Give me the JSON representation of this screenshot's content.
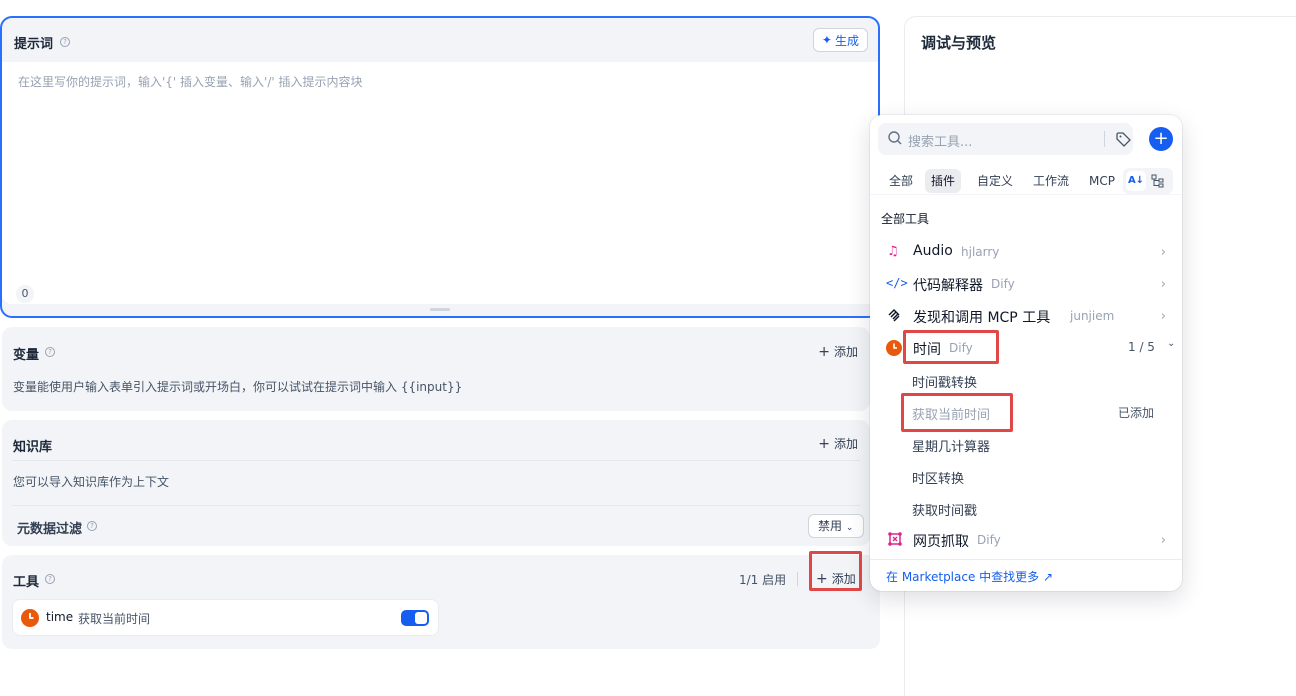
{
  "prompt": {
    "title": "提示词",
    "generate_label": "生成",
    "placeholder": "在这里写你的提示词，输入'{' 插入变量、输入'/' 插入提示内容块",
    "char_count": "0"
  },
  "variables": {
    "title": "变量",
    "add_label": "添加",
    "description": "变量能使用户输入表单引入提示词或开场白，你可以试试在提示词中输入 {{input}}"
  },
  "knowledge": {
    "title": "知识库",
    "add_label": "添加",
    "description": "您可以导入知识库作为上下文",
    "metadata_filter_label": "元数据过滤",
    "metadata_filter_value": "禁用"
  },
  "tools": {
    "title": "工具",
    "enabled_count": "1/1 启用",
    "add_label": "添加",
    "items": [
      {
        "name": "time",
        "action": "获取当前时间",
        "enabled": true
      }
    ]
  },
  "debug": {
    "title": "调试与预览"
  },
  "tool_picker": {
    "search_placeholder": "搜索工具...",
    "tabs": [
      "全部",
      "插件",
      "自定义",
      "工作流",
      "MCP"
    ],
    "active_tab": "插件",
    "section_label": "全部工具",
    "tools": [
      {
        "name": "Audio",
        "author": "hjlarry",
        "icon": "audio-icon"
      },
      {
        "name": "代码解释器",
        "author": "Dify",
        "icon": "code-icon"
      },
      {
        "name": "发现和调用 MCP 工具",
        "author": "junjiem",
        "icon": "mcp-icon"
      },
      {
        "name": "时间",
        "author": "Dify",
        "icon": "clock-icon",
        "count": "1 / 5"
      },
      {
        "name": "网页抓取",
        "author": "Dify",
        "icon": "web-scraper-icon"
      }
    ],
    "time_actions": [
      {
        "label": "时间戳转换",
        "added": false
      },
      {
        "label": "获取当前时间",
        "added": true,
        "status": "已添加"
      },
      {
        "label": "星期几计算器",
        "added": false
      },
      {
        "label": "时区转换",
        "added": false
      },
      {
        "label": "获取时间戳",
        "added": false
      }
    ],
    "marketplace_link": "在 Marketplace 中查找更多 ↗"
  },
  "colors": {
    "accent": "#2970ff",
    "highlight": "#e04848",
    "clock": "#e8590c"
  }
}
